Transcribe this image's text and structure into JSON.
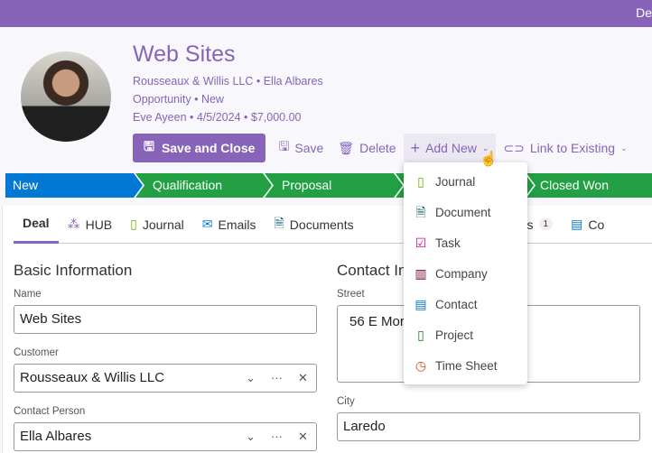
{
  "topbar": {
    "text": "De"
  },
  "header": {
    "title": "Web Sites",
    "line1": [
      "Rousseaux & Willis LLC",
      "Ella Albares"
    ],
    "line2": [
      "Opportunity",
      "New"
    ],
    "line3": [
      "Eve Ayeen",
      "4/5/2024",
      "$7,000.00"
    ]
  },
  "toolbar": {
    "save_close": "Save and Close",
    "save": "Save",
    "delete": "Delete",
    "add_new": "Add New",
    "link_existing": "Link to Existing"
  },
  "stages": [
    "New",
    "Qualification",
    "Proposal",
    "",
    "Closed Won"
  ],
  "tabs": [
    {
      "label": "Deal"
    },
    {
      "label": "HUB"
    },
    {
      "label": "Journal"
    },
    {
      "label": "Emails"
    },
    {
      "label": "Documents"
    },
    {
      "label": "mpanies",
      "badge": "1"
    },
    {
      "label": "Co"
    }
  ],
  "basic": {
    "title": "Basic Information",
    "name_label": "Name",
    "name": "Web Sites",
    "customer_label": "Customer",
    "customer": "Rousseaux & Willis LLC",
    "contact_label": "Contact Person",
    "contact": "Ella Albares"
  },
  "contact_info": {
    "title": "Contact In",
    "street_label": "Street",
    "street": "56 E Mor",
    "city_label": "City",
    "city": "Laredo"
  },
  "menu": [
    {
      "label": "Journal",
      "icon": "journal-icon",
      "color": "#6bb700"
    },
    {
      "label": "Document",
      "icon": "document-icon",
      "color": "#0b556a"
    },
    {
      "label": "Task",
      "icon": "task-icon",
      "color": "#e3008c"
    },
    {
      "label": "Company",
      "icon": "company-icon",
      "color": "#750b1c"
    },
    {
      "label": "Contact",
      "icon": "contact-icon",
      "color": "#0078d4"
    },
    {
      "label": "Project",
      "icon": "project-icon",
      "color": "#107c10"
    },
    {
      "label": "Time Sheet",
      "icon": "timesheet-icon",
      "color": "#ca5010"
    }
  ],
  "colors": {
    "accent": "#8764b8",
    "stage_active": "#0078d4",
    "stage": "#22a043"
  }
}
